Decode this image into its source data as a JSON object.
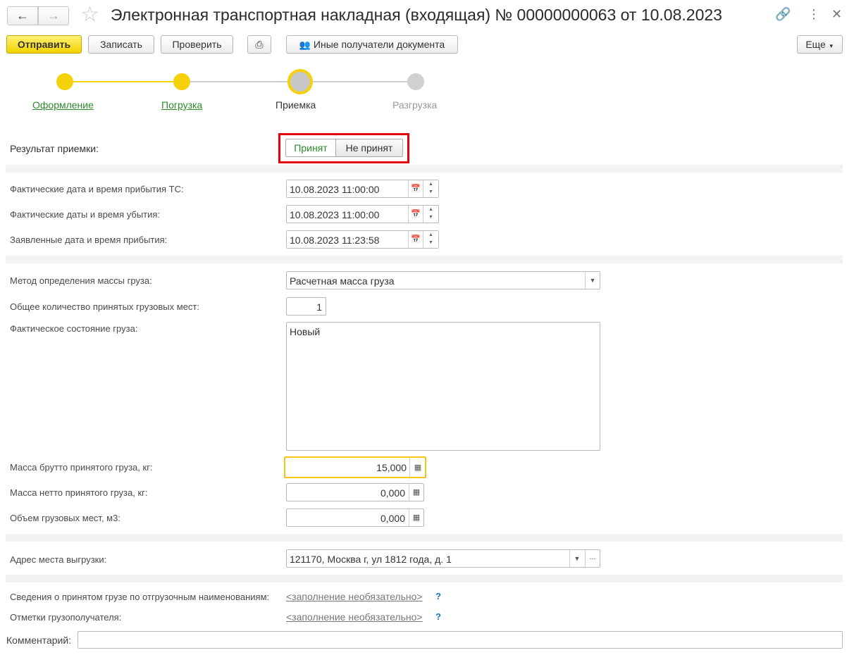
{
  "header": {
    "title": "Электронная транспортная накладная (входящая) № 00000000063 от 10.08.2023"
  },
  "toolbar": {
    "send": "Отправить",
    "save": "Записать",
    "check": "Проверить",
    "other_recipients": "Иные получатели документа",
    "more": "Еще"
  },
  "steps": [
    {
      "label": "Оформление",
      "state": "done"
    },
    {
      "label": "Погрузка",
      "state": "done"
    },
    {
      "label": "Приемка",
      "state": "current"
    },
    {
      "label": "Разгрузка",
      "state": "pending"
    }
  ],
  "result": {
    "label": "Результат приемки:",
    "accepted": "Принят",
    "not_accepted": "Не принят"
  },
  "dates": {
    "arrival_label": "Фактические дата и время прибытия ТС:",
    "arrival_value": "10.08.2023 11:00:00",
    "departure_label": "Фактические даты и время убытия:",
    "departure_value": "10.08.2023 11:00:00",
    "declared_label": "Заявленные дата и время прибытия:",
    "declared_value": "10.08.2023 11:23:58"
  },
  "cargo": {
    "method_label": "Метод определения массы груза:",
    "method_value": "Расчетная масса груза",
    "places_label": "Общее количество принятых грузовых мест:",
    "places_value": "1",
    "state_label": "Фактическое состояние груза:",
    "state_value": "Новый",
    "gross_label": "Масса брутто принятого груза, кг:",
    "gross_value": "15,000",
    "net_label": "Масса нетто принятого груза, кг:",
    "net_value": "0,000",
    "volume_label": "Объем грузовых мест, м3:",
    "volume_value": "0,000"
  },
  "address": {
    "label": "Адрес места выгрузки:",
    "value": "121170, Москва г, ул 1812 года, д. 1"
  },
  "extra": {
    "shipping_names_label": "Сведения о принятом грузе по отгрузочным наименованиям:",
    "shipping_names_link": "<заполнение необязательно>",
    "consignee_marks_label": "Отметки грузополучателя:",
    "consignee_marks_link": "<заполнение необязательно>",
    "help_mark": "?",
    "comment_label": "Комментарий:",
    "comment_value": ""
  },
  "colors": {
    "accent_yellow": "#f5d10b",
    "step_link_green": "#2c8a2c",
    "pending_gray": "#c8c8c8",
    "highlight_red": "#e8000d"
  }
}
